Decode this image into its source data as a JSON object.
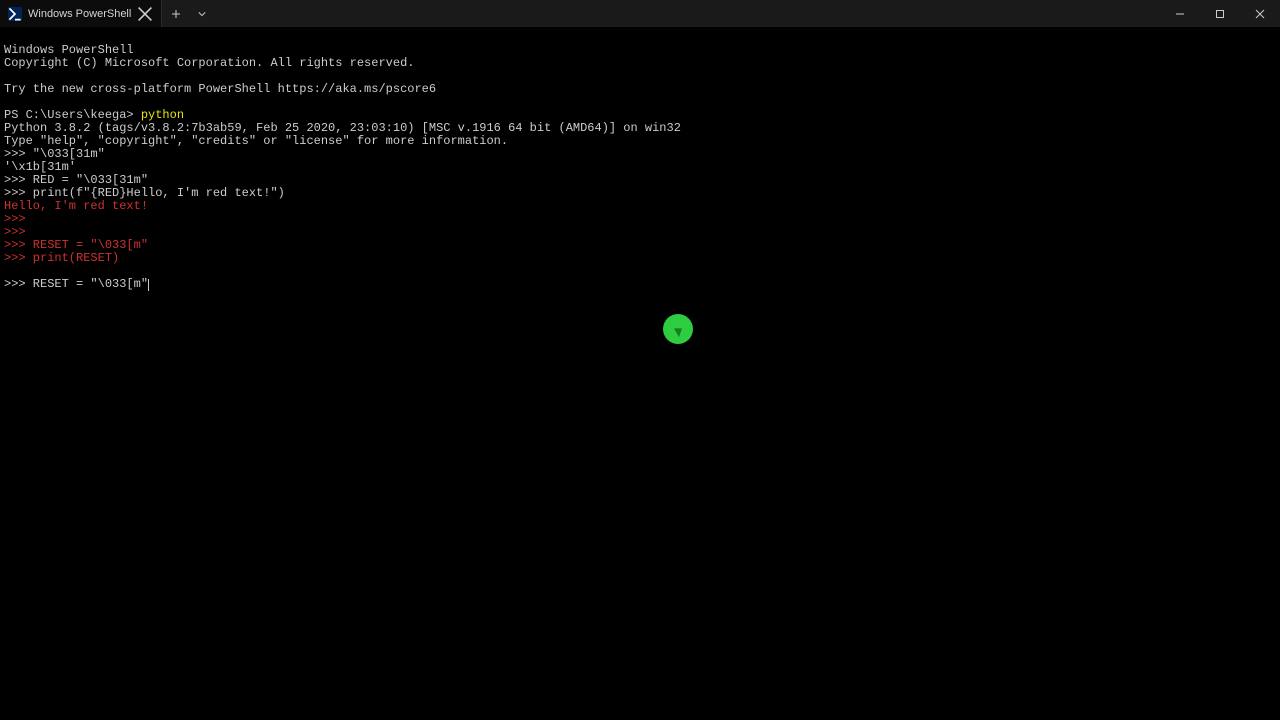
{
  "titlebar": {
    "tab_title": "Windows PowerShell"
  },
  "lines": {
    "l1": "Windows PowerShell",
    "l2": "Copyright (C) Microsoft Corporation. All rights reserved.",
    "l3": "",
    "l4": "Try the new cross-platform PowerShell https://aka.ms/pscore6",
    "l5": "",
    "l6_a": "PS C:\\Users\\keega> ",
    "l6_b": "python",
    "l7": "Python 3.8.2 (tags/v3.8.2:7b3ab59, Feb 25 2020, 23:03:10) [MSC v.1916 64 bit (AMD64)] on win32",
    "l8": "Type \"help\", \"copyright\", \"credits\" or \"license\" for more information.",
    "l9": ">>> \"\\033[31m\"",
    "l10": "'\\x1b[31m'",
    "l11": ">>> RED = \"\\033[31m\"",
    "l12": ">>> print(f\"{RED}Hello, I'm red text!\")",
    "l13": "Hello, I'm red text!",
    "l14": ">>>",
    "l15": ">>>",
    "l16": ">>> RESET = \"\\033[m\"",
    "l17": ">>> print(RESET)",
    "l18": "",
    "l19": ">>> RESET = \"\\033[m\""
  }
}
